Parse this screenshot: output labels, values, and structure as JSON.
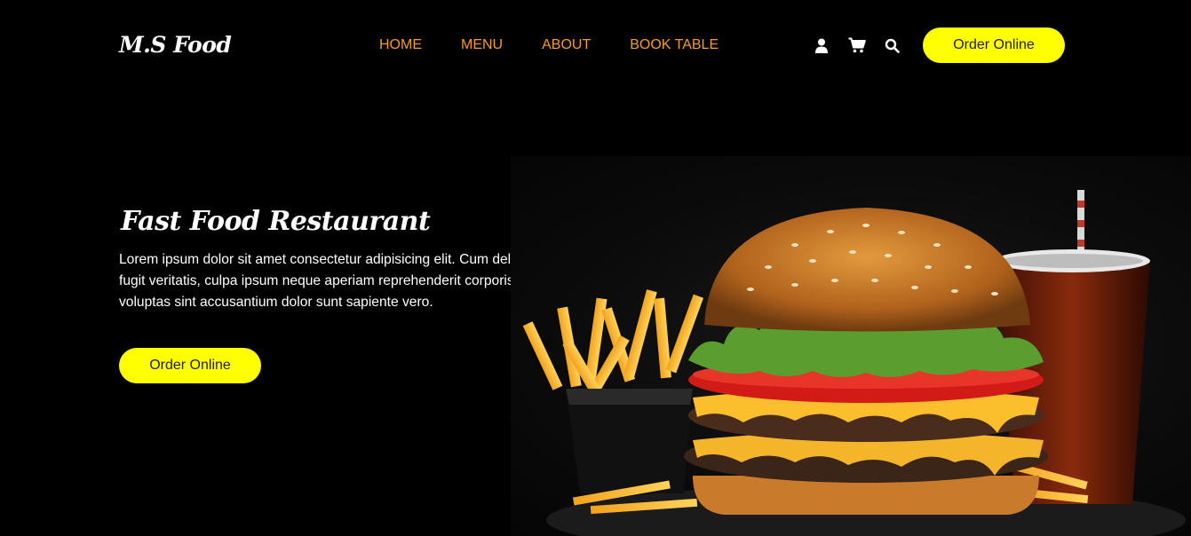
{
  "brand": {
    "name": "M.S Food"
  },
  "nav": {
    "links": [
      "HOME",
      "MENU",
      "ABOUT",
      "BOOK TABLE"
    ],
    "icons": [
      "user-icon",
      "cart-icon",
      "search-icon"
    ],
    "order_label": "Order Online"
  },
  "hero": {
    "title": "Fast Food Restaurant",
    "description": "Lorem ipsum dolor sit amet consectetur adipisicing elit. Cum deleniti eum quo soluta fugit veritatis, culpa ipsum neque aperiam reprehenderit corporis asperiores magni voluptas sint accusantium dolor sunt sapiente vero.",
    "order_label": "Order Online",
    "image": "burger-fries-soda-image"
  },
  "colors": {
    "background": "#000000",
    "nav_link": "#f59e1b",
    "button": "#ffff00",
    "button_text": "#222222",
    "text": "#ffffff"
  }
}
